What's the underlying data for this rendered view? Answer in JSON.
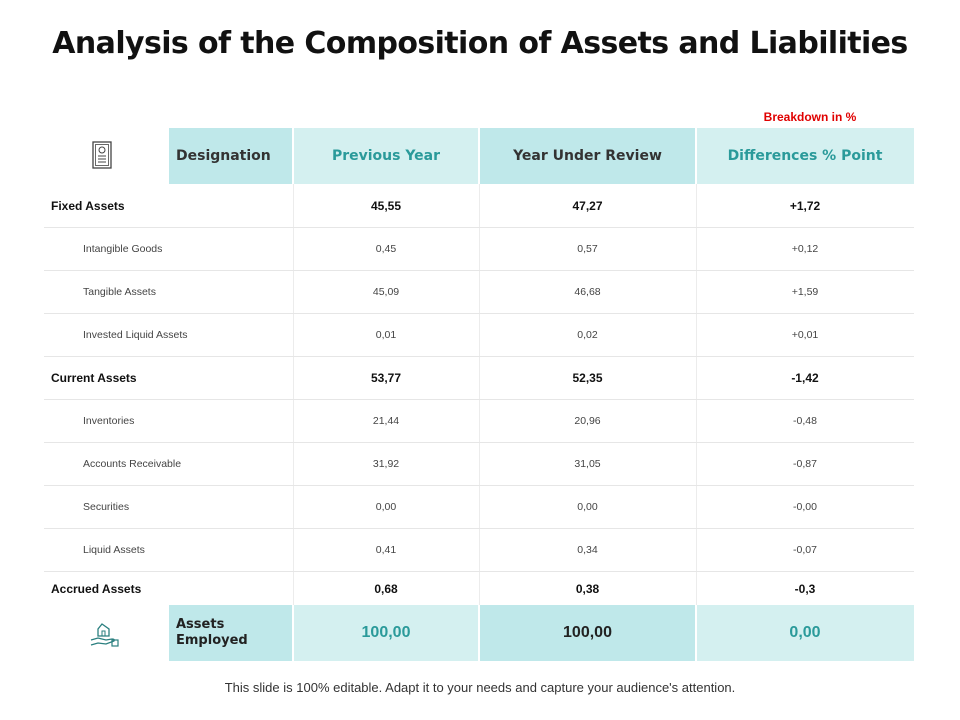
{
  "title": "Analysis of the Composition of Assets and Liabilities",
  "breakdown_label": "Breakdown in %",
  "headers": {
    "designation": "Designation",
    "previous_year": "Previous Year",
    "year_under_review": "Year Under Review",
    "differences": "Differences % Point"
  },
  "rows": [
    {
      "label": "Fixed Assets",
      "prev": "45,55",
      "curr": "47,27",
      "diff": "+1,72"
    },
    {
      "label": "Intangible Goods",
      "prev": "0,45",
      "curr": "0,57",
      "diff": "+0,12"
    },
    {
      "label": "Tangible Assets",
      "prev": "45,09",
      "curr": "46,68",
      "diff": "+1,59"
    },
    {
      "label": "Invested Liquid Assets",
      "prev": "0,01",
      "curr": "0,02",
      "diff": "+0,01"
    },
    {
      "label": "Current Assets",
      "prev": "53,77",
      "curr": "52,35",
      "diff": "-1,42"
    },
    {
      "label": "Inventories",
      "prev": "21,44",
      "curr": "20,96",
      "diff": "-0,48"
    },
    {
      "label": "Accounts Receivable",
      "prev": "31,92",
      "curr": "31,05",
      "diff": "-0,87"
    },
    {
      "label": "Securities",
      "prev": "0,00",
      "curr": "0,00",
      "diff": "-0,00"
    },
    {
      "label": "Liquid Assets",
      "prev": "0,41",
      "curr": "0,34",
      "diff": "-0,07"
    },
    {
      "label": "Accrued Assets",
      "prev": "0,68",
      "curr": "0,38",
      "diff": "-0,3"
    }
  ],
  "total": {
    "label_line1": "Assets",
    "label_line2": "Employed",
    "prev": "100,00",
    "curr": "100,00",
    "diff": "0,00"
  },
  "icons": {
    "header": "certificate-icon",
    "footer": "hand-house-icon"
  },
  "colors": {
    "header_light": "#d4f0f0",
    "header_dark": "#bfe8ea",
    "teal_text": "#2a9a9a",
    "red_note": "#e00000"
  },
  "footer_note": "This slide is 100% editable. Adapt it to your needs and capture your audience's attention."
}
